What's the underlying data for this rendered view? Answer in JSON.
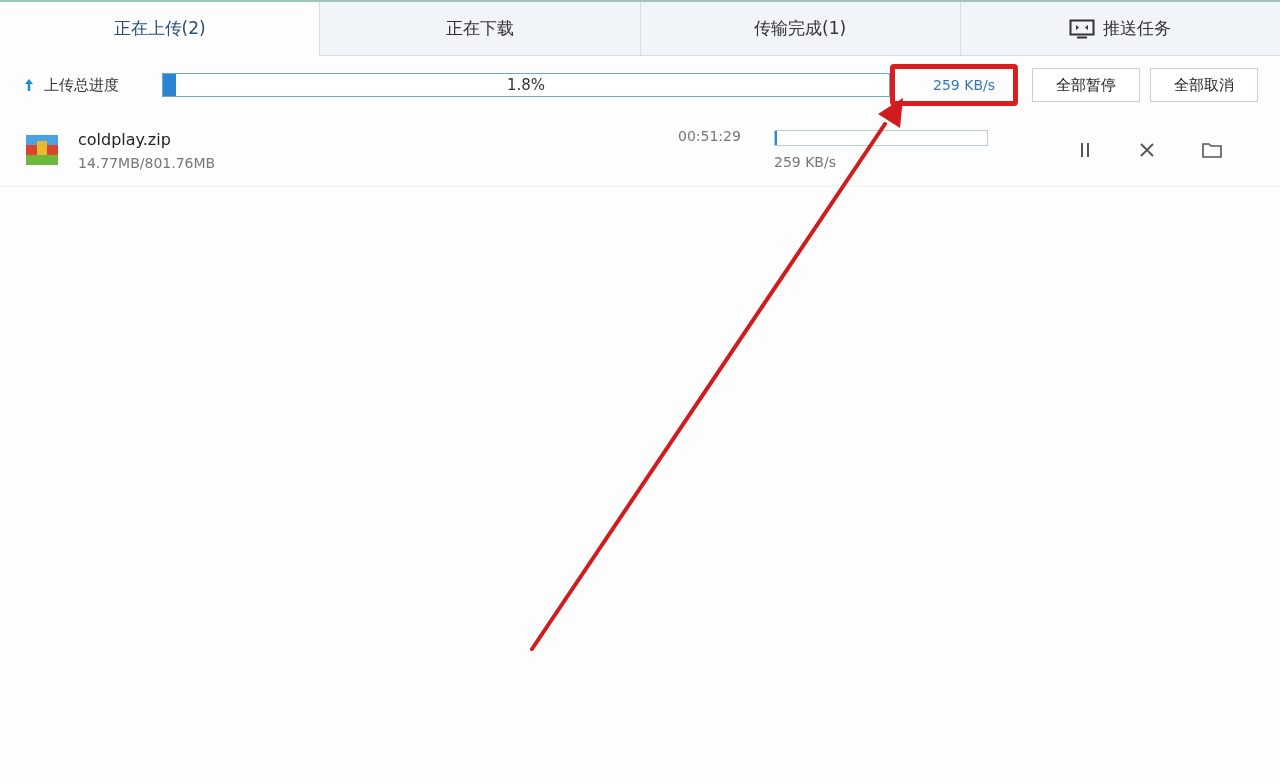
{
  "tabs": [
    {
      "label": "正在上传(2)",
      "selected": true,
      "kind": "text"
    },
    {
      "label": "正在下载",
      "selected": false,
      "kind": "text"
    },
    {
      "label": "传输完成(1)",
      "selected": false,
      "kind": "text"
    },
    {
      "label": "推送任务",
      "selected": false,
      "kind": "icon"
    }
  ],
  "total": {
    "label": "上传总进度",
    "level": 0.018,
    "percent": "1.8%",
    "speed": "259 KB/s",
    "buttons": [
      "全部暂停",
      "全部取消"
    ]
  },
  "files": [
    {
      "name": "coldplay.zip",
      "size": "14.77MB/801.76MB",
      "time": "00:51:29",
      "level": 0.01,
      "speed": "259 KB/s"
    }
  ],
  "annotation": {
    "highlight_speed": true,
    "arrow": true
  }
}
